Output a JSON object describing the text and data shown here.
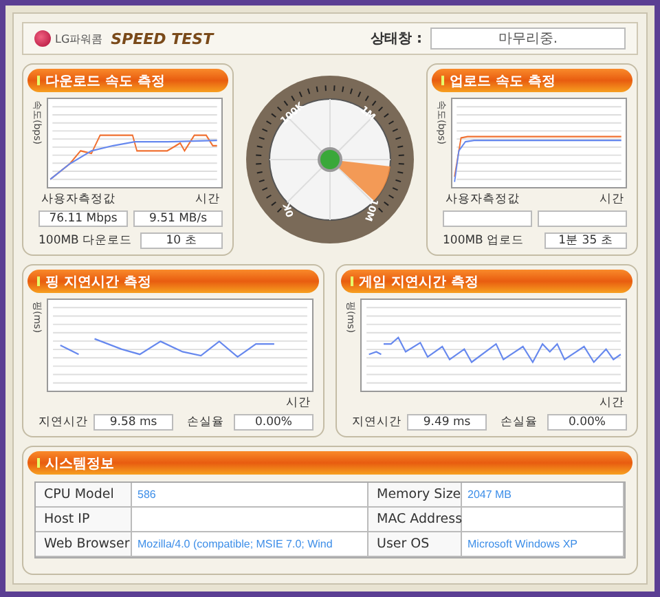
{
  "header": {
    "logo": "LG파워콤",
    "title": "SPEED TEST",
    "status_label": "상태창 :",
    "status_value": "마무리중."
  },
  "download": {
    "title": "다운로드 속도 측정",
    "ylabel": "속도(bps)",
    "xlabel": "시간",
    "user_label": "사용자측정값",
    "speed_mbps": "76.11 Mbps",
    "speed_mbs": "9.51 MB/s",
    "file_label": "100MB 다운로드",
    "file_time": "10 초"
  },
  "gauge": {
    "labels": [
      "100K",
      "1M",
      "10M",
      "0K"
    ]
  },
  "upload": {
    "title": "업로드 속도 측정",
    "ylabel": "속도(bps)",
    "xlabel": "시간",
    "user_label": "사용자측정값",
    "file_label": "100MB 업로드",
    "file_time": "1분 35 초"
  },
  "ping": {
    "title": "핑 지연시간 측정",
    "ylabel": "핑(ms)",
    "xlabel": "시간",
    "latency_label": "지연시간",
    "latency": "9.58 ms",
    "loss_label": "손실율",
    "loss": "0.00%"
  },
  "game": {
    "title": "게임 지연시간 측정",
    "ylabel": "핑(ms)",
    "xlabel": "시간",
    "latency_label": "지연시간",
    "latency": "9.49 ms",
    "loss_label": "손실율",
    "loss": "0.00%"
  },
  "system": {
    "title": "시스템정보",
    "rows": [
      {
        "label": "CPU Model",
        "value": "586",
        "label2": "Memory Size",
        "value2": "2047 MB"
      },
      {
        "label": "Host IP",
        "label2": "MAC Address"
      },
      {
        "label": "Web Browser",
        "value": "Mozilla/4.0 (compatible; MSIE 7.0; Wind",
        "label2": "User OS",
        "value2": "Microsoft Windows XP"
      }
    ]
  }
}
